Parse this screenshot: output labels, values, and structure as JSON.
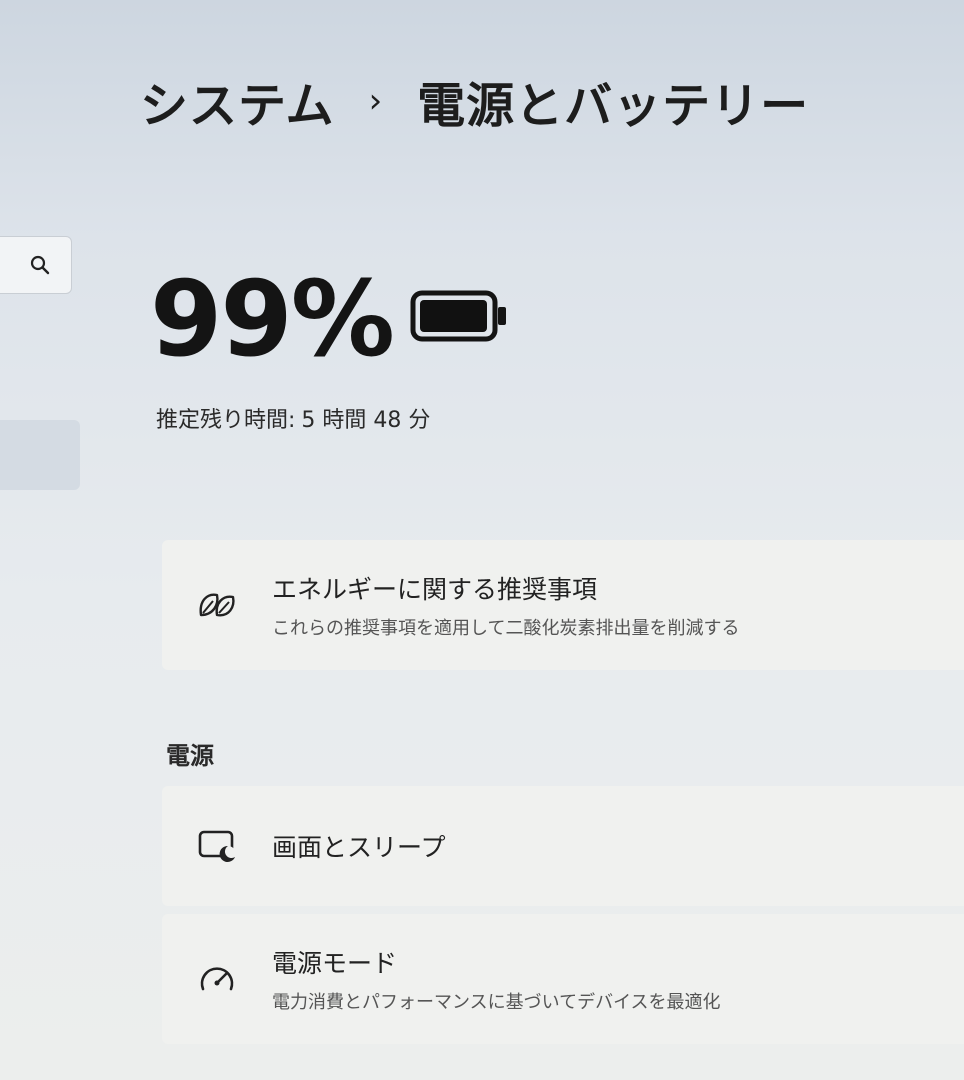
{
  "breadcrumb": {
    "parent": "システム",
    "separator": "›",
    "current": "電源とバッテリー"
  },
  "search": {
    "icon": "search-icon"
  },
  "battery": {
    "percent_label": "99%",
    "level": 0.99,
    "remaining_label": "推定残り時間:",
    "remaining_value": "5 時間 48 分"
  },
  "energy_card": {
    "title": "エネルギーに関する推奨事項",
    "subtitle": "これらの推奨事項を適用して二酸化炭素排出量を削減する",
    "icon": "leaf-icon"
  },
  "power_section": {
    "title": "電源",
    "items": [
      {
        "title": "画面とスリープ",
        "icon": "screen-sleep-icon"
      },
      {
        "title": "電源モード",
        "subtitle": "電力消費とパフォーマンスに基づいてデバイスを最適化",
        "icon": "gauge-icon"
      }
    ]
  }
}
